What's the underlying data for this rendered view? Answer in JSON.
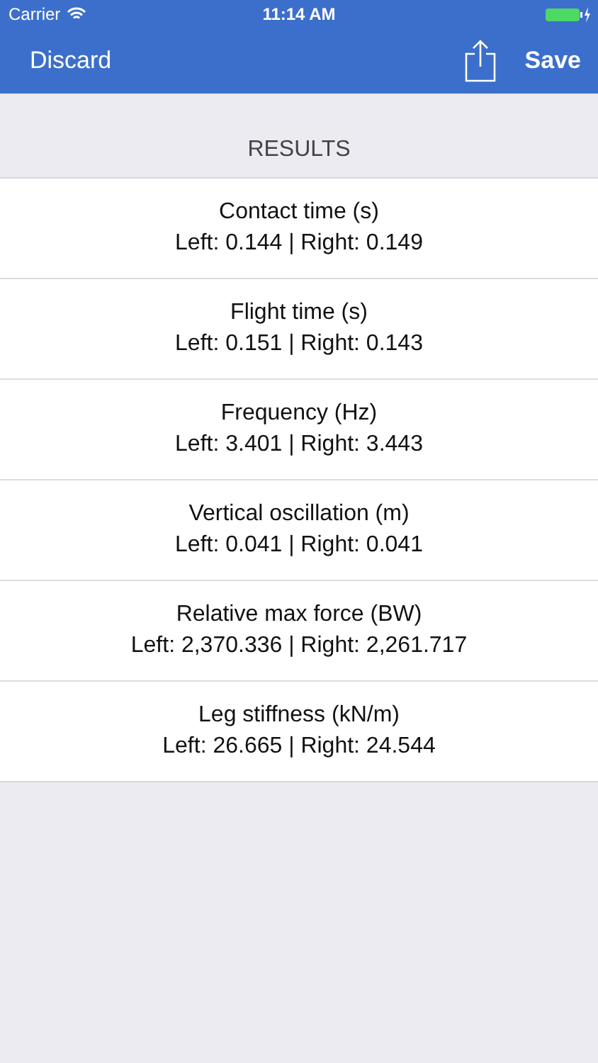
{
  "status_bar": {
    "carrier": "Carrier",
    "time": "11:14 AM"
  },
  "nav_bar": {
    "left_button": "Discard",
    "right_button": "Save"
  },
  "section_header": "RESULTS",
  "results": [
    {
      "title": "Contact time (s)",
      "value": "Left: 0.144 | Right: 0.149"
    },
    {
      "title": "Flight time (s)",
      "value": "Left: 0.151 | Right: 0.143"
    },
    {
      "title": "Frequency (Hz)",
      "value": "Left: 3.401 | Right: 3.443"
    },
    {
      "title": "Vertical oscillation (m)",
      "value": "Left: 0.041 | Right: 0.041"
    },
    {
      "title": "Relative max force (BW)",
      "value": "Left: 2,370.336 | Right: 2,261.717"
    },
    {
      "title": "Leg stiffness (kN/m)",
      "value": "Left: 26.665 | Right: 24.544"
    }
  ]
}
